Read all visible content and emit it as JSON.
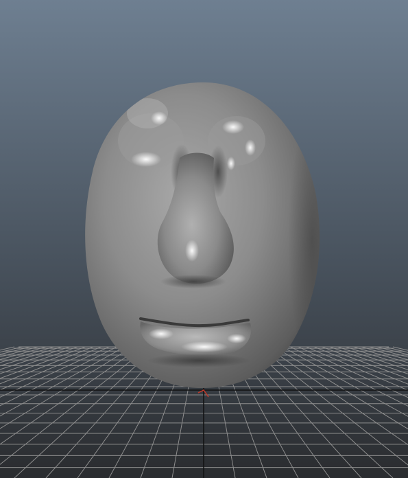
{
  "viewport": {
    "background_top": "#6e7f91",
    "background_bottom": "#2a2c2f",
    "grid_line_color": "#8e8e8e",
    "grid_axis_color": "#111111",
    "grid_origin_marker_color": "#c0392b"
  },
  "model": {
    "name": "head",
    "base_color": "#8a8a8a",
    "highlight_color": "#e6e6e6",
    "shadow_color": "#3c3c3c"
  }
}
